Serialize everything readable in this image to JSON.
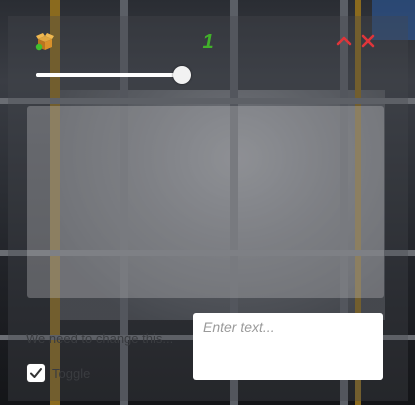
{
  "header": {
    "icon": "open-box-icon",
    "count": "1"
  },
  "controls": {
    "collapse_icon": "chevron-up-icon",
    "close_icon": "close-x-icon",
    "accent_color": "#e0353a"
  },
  "slider": {
    "value_fraction": 1.0
  },
  "form": {
    "hint_text": "We need to change this...",
    "input_placeholder": "Enter text...",
    "input_value": "",
    "checkbox_checked": true,
    "checkbox_label": "Toggle"
  },
  "colors": {
    "count_color": "#41b12a",
    "box_icon_color": "#d9902a",
    "badge_color": "#3fbf2e"
  }
}
